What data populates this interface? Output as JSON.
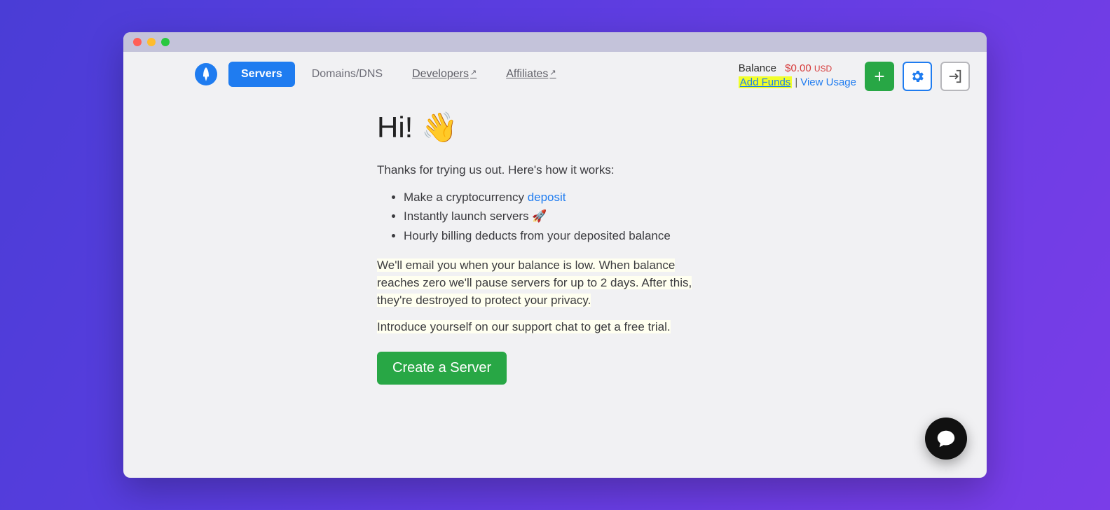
{
  "nav": {
    "tabs": [
      {
        "label": "Servers",
        "active": true,
        "external": false
      },
      {
        "label": "Domains/DNS",
        "active": false,
        "external": false
      },
      {
        "label": "Developers",
        "active": false,
        "external": true
      },
      {
        "label": "Affiliates",
        "active": false,
        "external": true
      }
    ]
  },
  "balance": {
    "label": "Balance",
    "amount": "$0.00",
    "currency": "USD",
    "add_funds": "Add Funds",
    "view_usage": "View Usage"
  },
  "icons": {
    "add": "plus-icon",
    "settings": "gear-icon",
    "logout": "exit-icon",
    "chat": "chat-icon"
  },
  "welcome": {
    "heading": "Hi!",
    "emoji": "👋",
    "intro": "Thanks for trying us out. Here's how it works:",
    "bullets": {
      "b1_prefix": "Make a cryptocurrency ",
      "b1_link": "deposit",
      "b2": "Instantly launch servers 🚀",
      "b3": "Hourly billing deducts from your deposited balance"
    },
    "notice": "We'll email you when your balance is low. When balance reaches zero we'll pause servers for up to 2 days. After this, they're destroyed to protect your privacy.",
    "trial": "Introduce yourself on our support chat to get a free trial.",
    "cta": "Create a Server"
  }
}
